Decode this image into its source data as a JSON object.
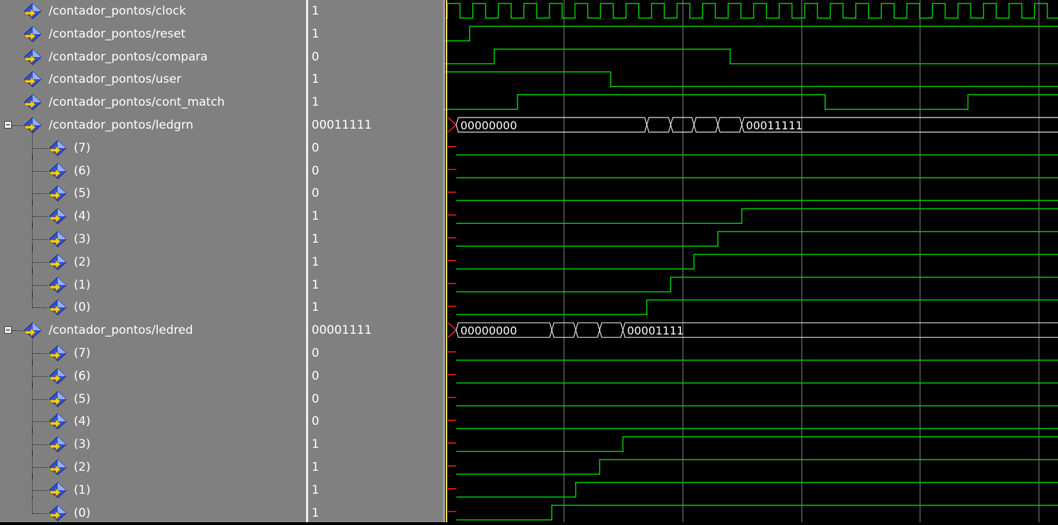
{
  "signals": [
    {
      "name": "/contador_pontos/clock",
      "value": "1",
      "type": "clock"
    },
    {
      "name": "/contador_pontos/reset",
      "value": "1",
      "type": "bit",
      "initial": 0,
      "transitions": [
        0.04
      ]
    },
    {
      "name": "/contador_pontos/compara",
      "value": "0",
      "type": "bit",
      "initial": 0,
      "transitions": [
        0.08,
        0.465
      ]
    },
    {
      "name": "/contador_pontos/user",
      "value": "1",
      "type": "bit",
      "initial": 1,
      "transitions": [
        0.27
      ]
    },
    {
      "name": "/contador_pontos/cont_match",
      "value": "1",
      "type": "bit",
      "initial": 0,
      "transitions": [
        0.118,
        0.62,
        0.853
      ]
    },
    {
      "name": "/contador_pontos/ledgrn",
      "value": "00011111",
      "type": "bus",
      "expanded": true,
      "bus_segments": [
        {
          "start": 0.018,
          "text": "00000000"
        },
        {
          "start": 0.329,
          "text": ""
        },
        {
          "start": 0.368,
          "text": ""
        },
        {
          "start": 0.406,
          "text": ""
        },
        {
          "start": 0.445,
          "text": ""
        },
        {
          "start": 0.484,
          "text": "00011111"
        }
      ],
      "children": [
        {
          "name": "(7)",
          "value": "0",
          "initial": 0,
          "transitions": []
        },
        {
          "name": "(6)",
          "value": "0",
          "initial": 0,
          "transitions": []
        },
        {
          "name": "(5)",
          "value": "0",
          "initial": 0,
          "transitions": []
        },
        {
          "name": "(4)",
          "value": "1",
          "initial": 0,
          "transitions": [
            0.484
          ]
        },
        {
          "name": "(3)",
          "value": "1",
          "initial": 0,
          "transitions": [
            0.445
          ]
        },
        {
          "name": "(2)",
          "value": "1",
          "initial": 0,
          "transitions": [
            0.406
          ]
        },
        {
          "name": "(1)",
          "value": "1",
          "initial": 0,
          "transitions": [
            0.368
          ]
        },
        {
          "name": "(0)",
          "value": "1",
          "initial": 0,
          "transitions": [
            0.329
          ]
        }
      ]
    },
    {
      "name": "/contador_pontos/ledred",
      "value": "00001111",
      "type": "bus",
      "expanded": true,
      "bus_segments": [
        {
          "start": 0.018,
          "text": "00000000"
        },
        {
          "start": 0.174,
          "text": ""
        },
        {
          "start": 0.213,
          "text": ""
        },
        {
          "start": 0.252,
          "text": ""
        },
        {
          "start": 0.29,
          "text": "00001111"
        }
      ],
      "children": [
        {
          "name": "(7)",
          "value": "0",
          "initial": 0,
          "transitions": []
        },
        {
          "name": "(6)",
          "value": "0",
          "initial": 0,
          "transitions": []
        },
        {
          "name": "(5)",
          "value": "0",
          "initial": 0,
          "transitions": []
        },
        {
          "name": "(4)",
          "value": "0",
          "initial": 0,
          "transitions": []
        },
        {
          "name": "(3)",
          "value": "1",
          "initial": 0,
          "transitions": [
            0.29
          ]
        },
        {
          "name": "(2)",
          "value": "1",
          "initial": 0,
          "transitions": [
            0.252
          ]
        },
        {
          "name": "(1)",
          "value": "1",
          "initial": 0,
          "transitions": [
            0.213
          ]
        },
        {
          "name": "(0)",
          "value": "1",
          "initial": 0,
          "transitions": [
            0.174
          ]
        }
      ]
    }
  ],
  "clock_cycles": 24,
  "grid_fractions": [
    0.194,
    0.388,
    0.582,
    0.775,
    0.969
  ],
  "colors": {
    "wave": "#00d000",
    "bus": "#e8e8e8",
    "grid": "#8a8a8a",
    "cursor": "#f0e070",
    "undefined": "#ff2020",
    "names_bg": "#808080",
    "wave_bg": "#000000"
  },
  "icons": {
    "signal": "diamond-arrow-icon",
    "collapse": "minus-expander-icon"
  }
}
